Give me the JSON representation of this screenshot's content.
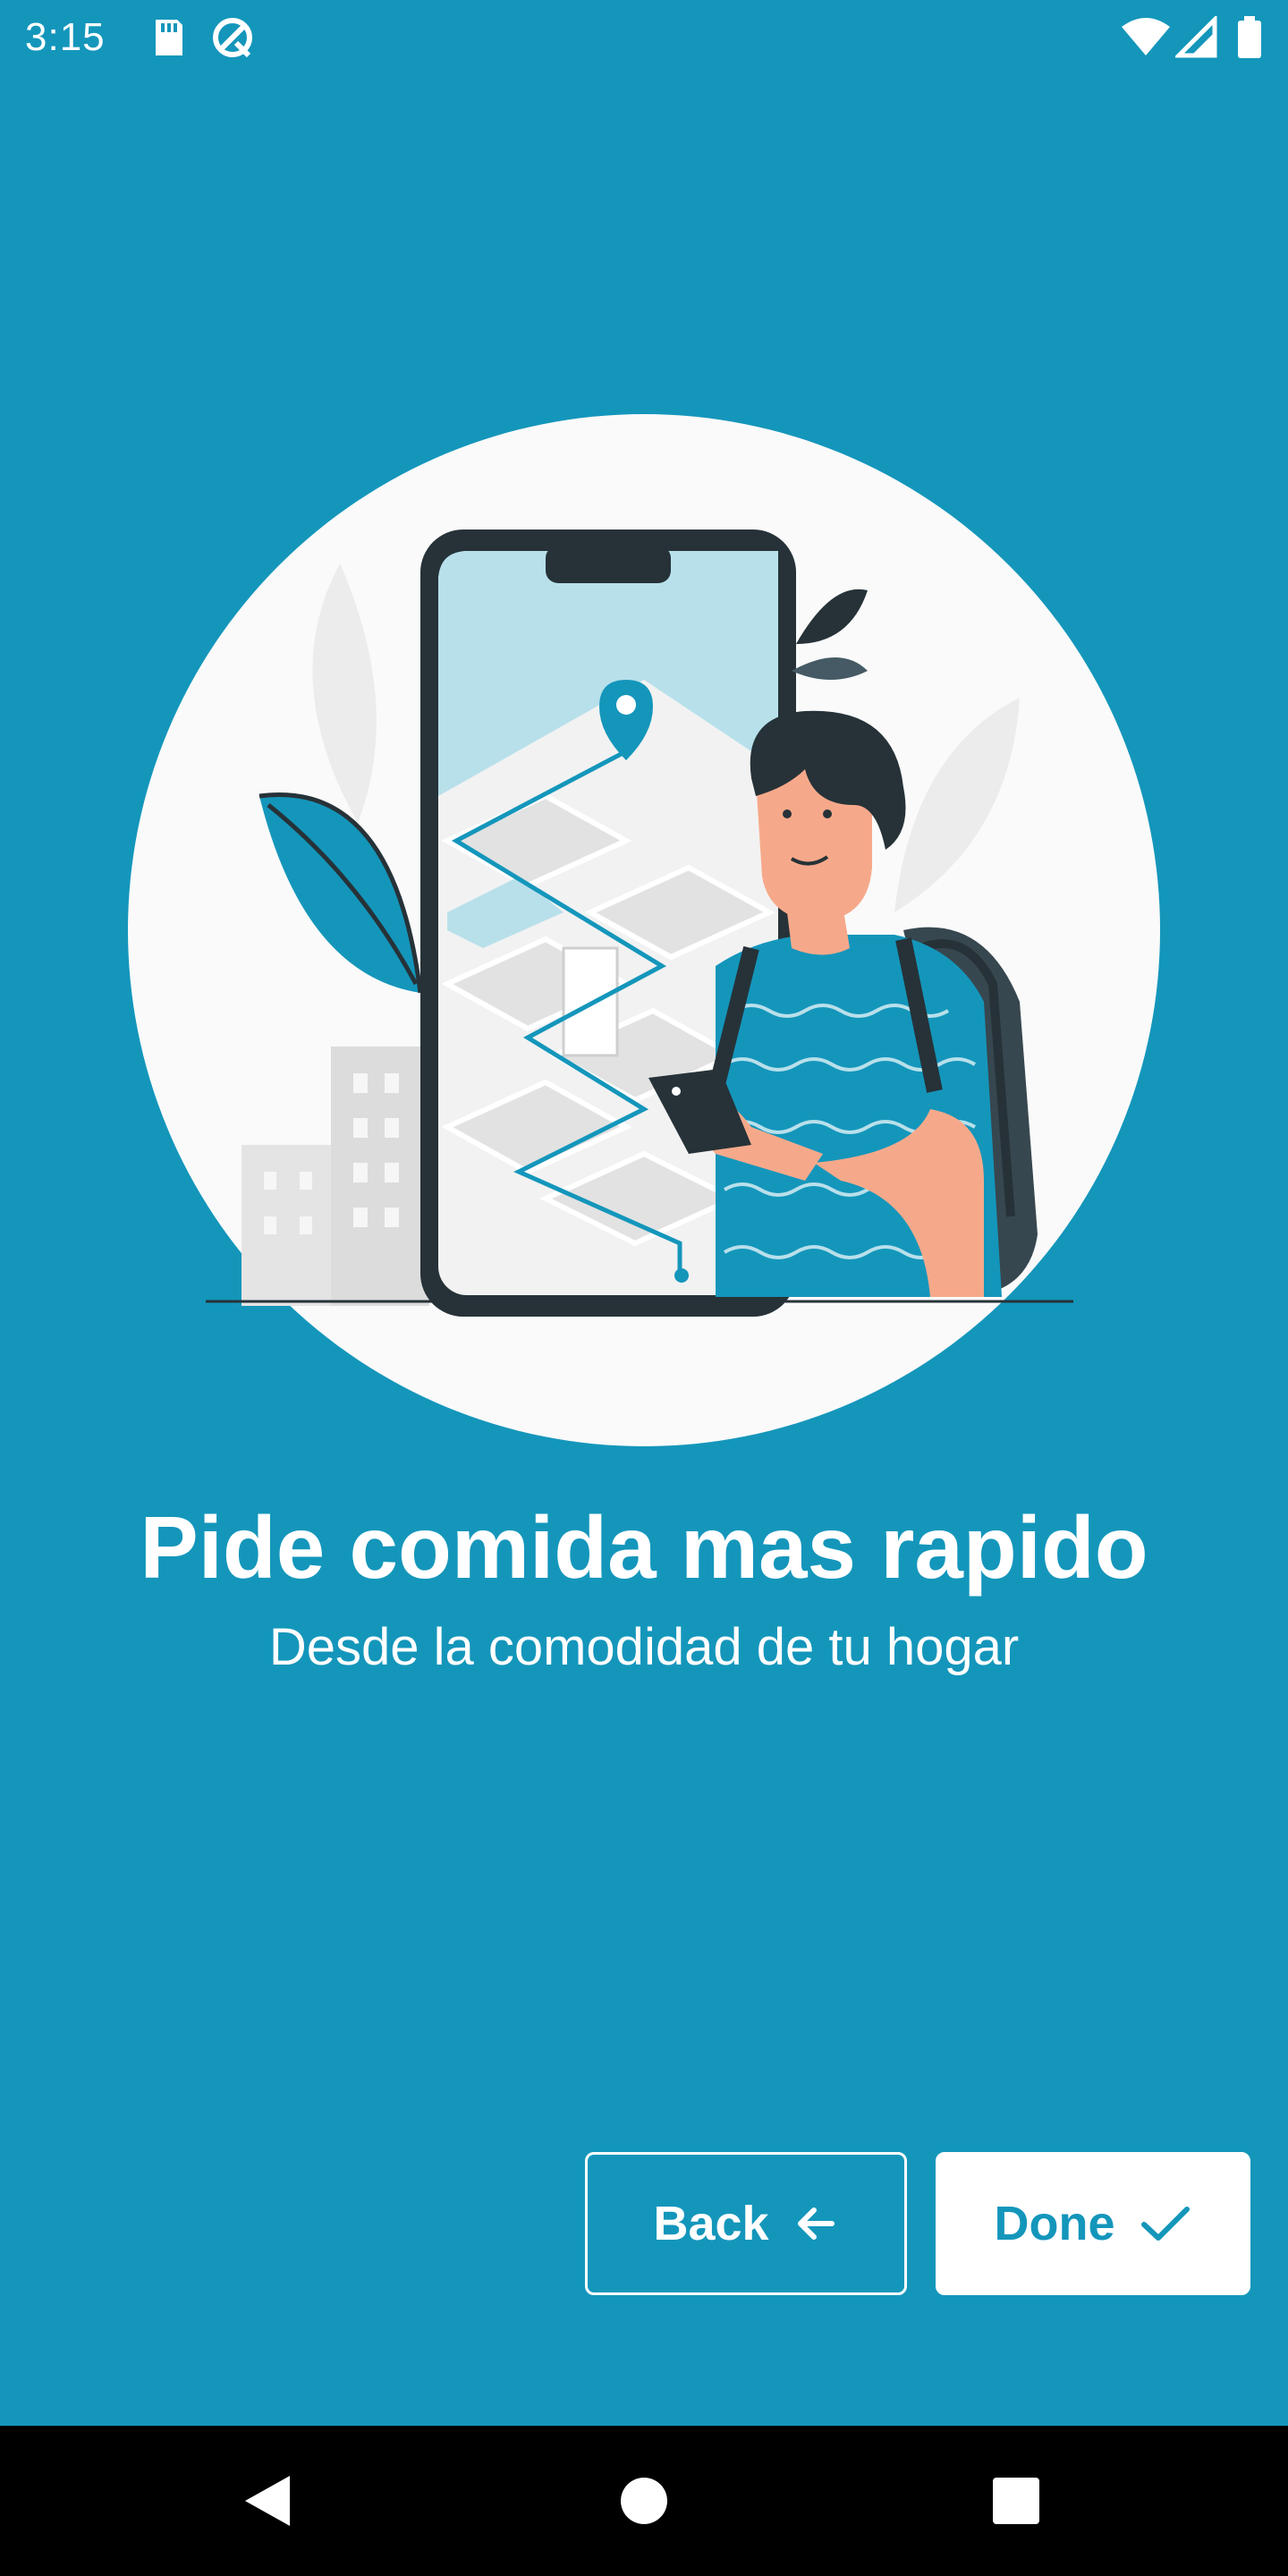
{
  "status_bar": {
    "time": "3:15",
    "icons": [
      "sd-card-icon",
      "no-disturb-icon",
      "wifi-icon",
      "signal-icon",
      "battery-icon"
    ]
  },
  "illustration": {
    "name": "phone-map-person-illustration"
  },
  "onboarding": {
    "title": "Pide comida mas rapido",
    "subtitle": "Desde la comodidad de tu hogar"
  },
  "buttons": {
    "back_label": "Back",
    "done_label": "Done"
  },
  "nav_bar": {
    "icons": [
      "back-triangle-icon",
      "home-circle-icon",
      "recents-square-icon"
    ]
  },
  "colors": {
    "background": "#1496bb",
    "accent": "#1496bb",
    "white": "#ffffff",
    "nav_bar": "#000000"
  }
}
